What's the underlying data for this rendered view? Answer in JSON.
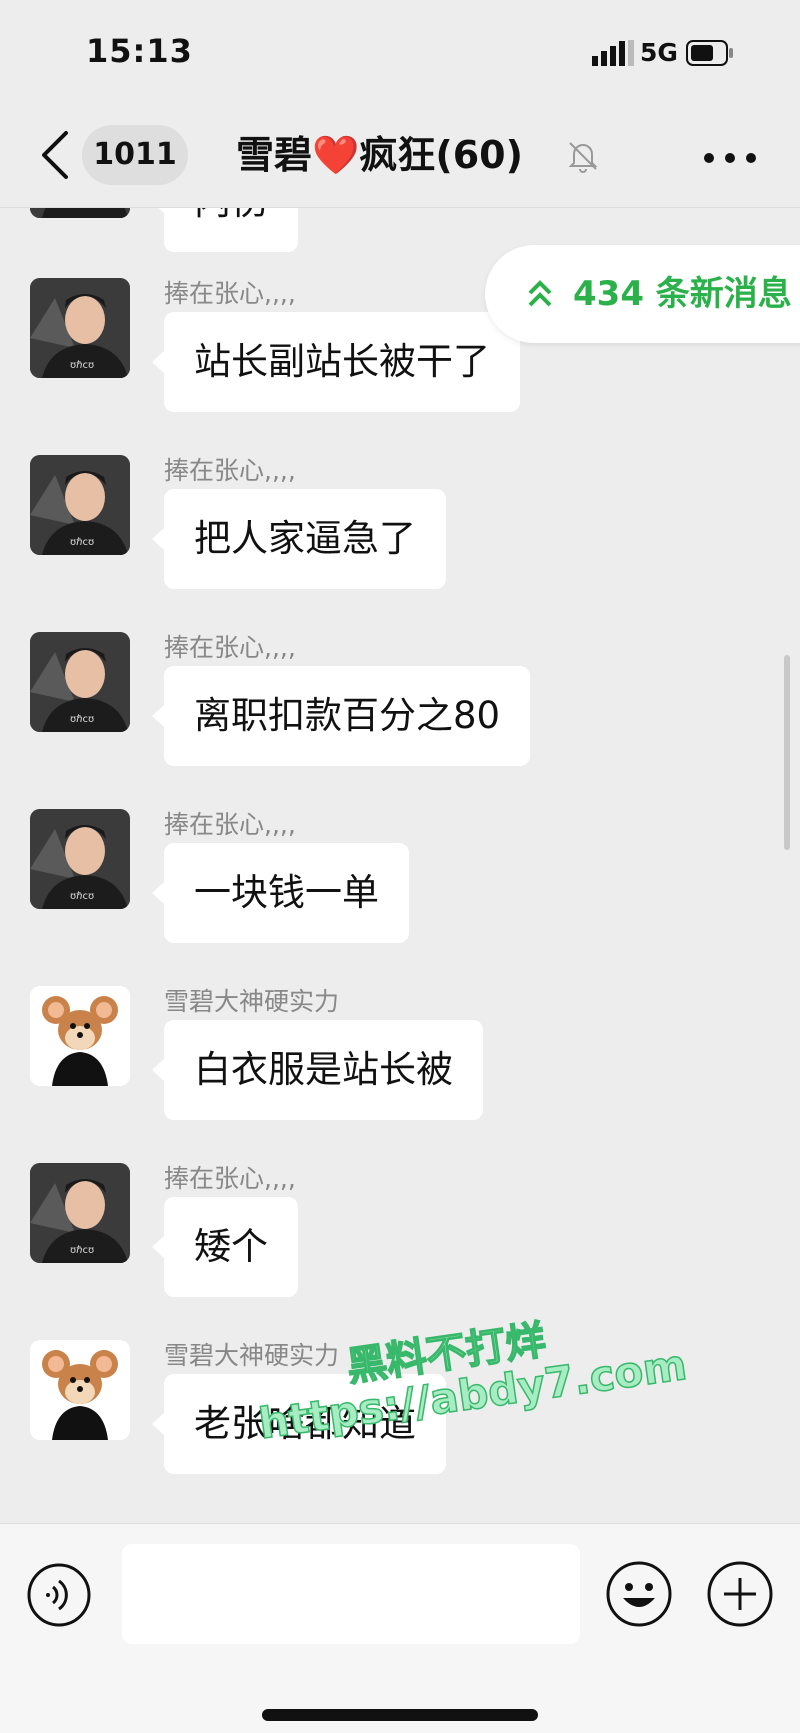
{
  "status_bar": {
    "time": "15:13",
    "network": "5G"
  },
  "nav": {
    "unread_count": "1011",
    "title_left": "雪碧",
    "title_heart": "❤️",
    "title_right": "疯狂(60)"
  },
  "new_messages": {
    "label": "434 条新消息"
  },
  "messages": [
    {
      "sender": "",
      "text": "内伤",
      "avatar": "man"
    },
    {
      "sender": "捧在张心,,,,",
      "text": "站长副站长被干了",
      "avatar": "man"
    },
    {
      "sender": "捧在张心,,,,",
      "text": "把人家逼急了",
      "avatar": "man"
    },
    {
      "sender": "捧在张心,,,,",
      "text": "离职扣款百分之80",
      "avatar": "man"
    },
    {
      "sender": "捧在张心,,,,",
      "text": "一块钱一单",
      "avatar": "man"
    },
    {
      "sender": "雪碧大神硬实力",
      "text": "白衣服是站长被",
      "avatar": "jerry"
    },
    {
      "sender": "捧在张心,,,,",
      "text": "矮个",
      "avatar": "man"
    },
    {
      "sender": "雪碧大神硬实力",
      "text": "老张啥都知道",
      "avatar": "jerry"
    }
  ],
  "watermark": {
    "line1": "黑料不打烊",
    "line2": "https://abdy7.com"
  },
  "icons": [
    "back-icon",
    "mute-bell-icon",
    "more-icon",
    "voice-icon",
    "emoji-icon",
    "plus-icon",
    "chevron-up-double-icon"
  ]
}
